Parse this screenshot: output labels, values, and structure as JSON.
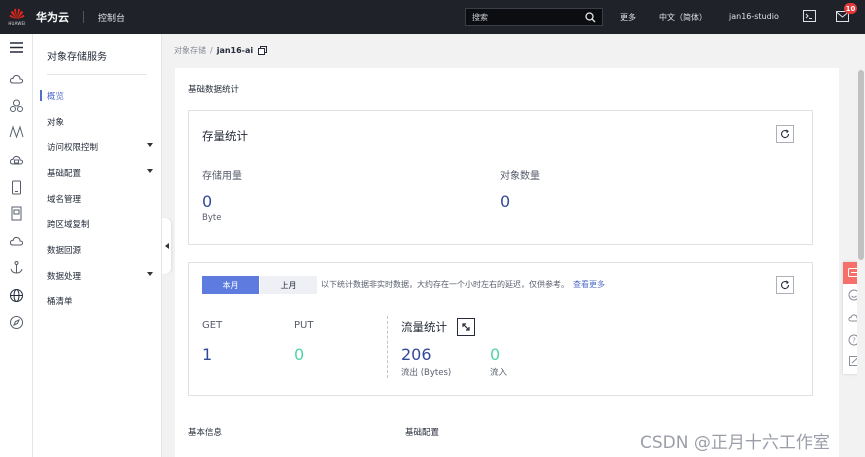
{
  "header": {
    "brand": "华为云",
    "logo_caption": "HUAWEI",
    "console": "控制台",
    "search_placeholder": "搜索",
    "more": "更多",
    "language": "中文（简体）",
    "user": "jan16-studio",
    "notification_count": "10"
  },
  "sidebar": {
    "title": "对象存储服务",
    "items": [
      {
        "label": "概览"
      },
      {
        "label": "对象"
      },
      {
        "label": "访问权限控制"
      },
      {
        "label": "基础配置"
      },
      {
        "label": "域名管理"
      },
      {
        "label": "跨区域复制"
      },
      {
        "label": "数据回源"
      },
      {
        "label": "数据处理"
      },
      {
        "label": "桶清单"
      }
    ]
  },
  "breadcrumb": {
    "parent": "对象存储",
    "separator": "/",
    "current": "jan16-ai"
  },
  "main": {
    "section_basic_stats": "基础数据统计",
    "storage": {
      "title": "存量统计",
      "usage_label": "存储用量",
      "usage_value": "0",
      "usage_unit": "Byte",
      "count_label": "对象数量",
      "count_value": "0"
    },
    "traffic": {
      "tab_this_month": "本月",
      "tab_last_month": "上月",
      "note": "以下统计数据非实时数据，大约存在一个小时左右的延迟，仅供参考。",
      "learn_more": "查看更多",
      "get_label": "GET",
      "get_value": "1",
      "put_label": "PUT",
      "put_value": "0",
      "flow_title": "流量统计",
      "out_value": "206",
      "out_label": "流出 (Bytes)",
      "in_value": "0",
      "in_label": "流入"
    },
    "section_basic_info": "基本信息",
    "section_basic_config": "基础配置"
  },
  "watermark": "CSDN @正月十六工作室",
  "colors": {
    "accent": "#5e7ce0",
    "value_blue": "#344899",
    "value_green": "#50d4ab",
    "topbar": "#1f2329"
  }
}
